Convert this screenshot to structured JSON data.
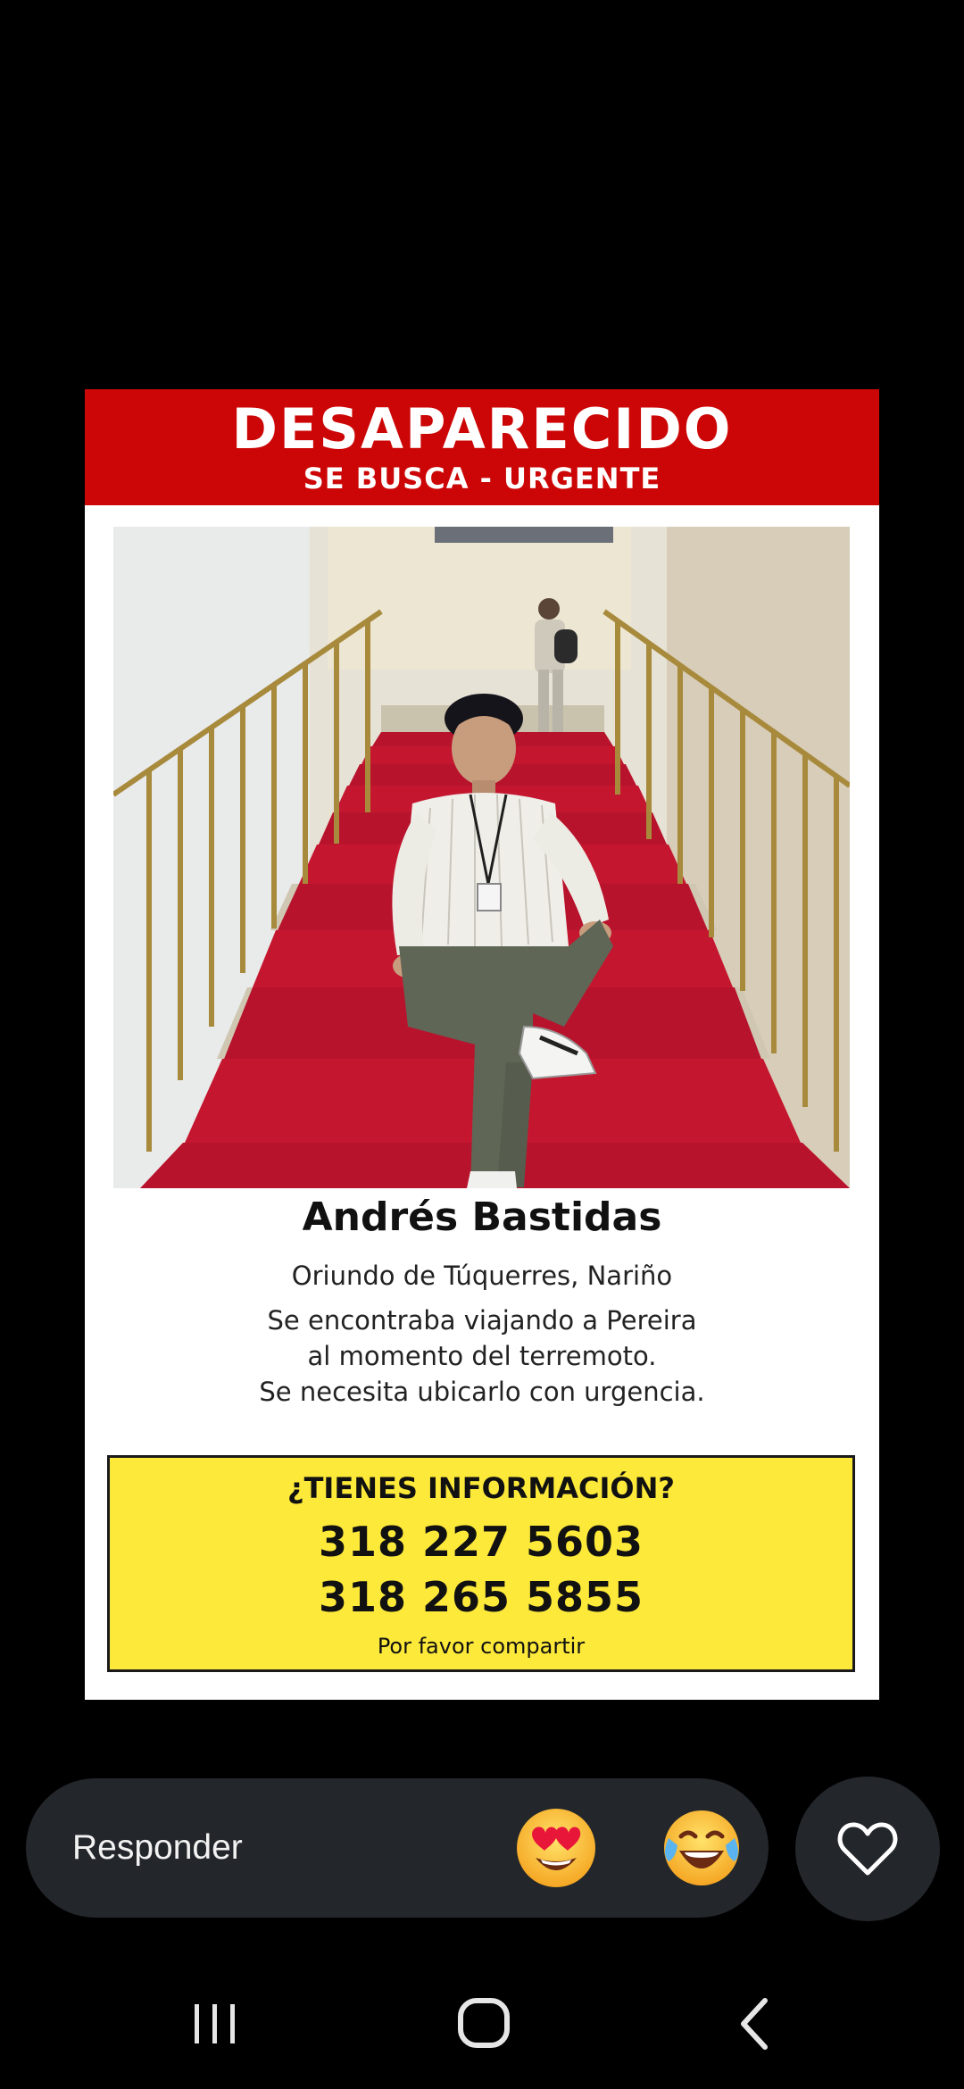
{
  "poster": {
    "title": "DESAPARECIDO",
    "subtitle": "SE BUSCA - URGENTE",
    "name": "Andrés Bastidas",
    "origin": "Oriundo de Túquerres, Nariño",
    "description_lines": [
      "Se encontraba viajando a Pereira",
      "al momento del terremoto.",
      "Se necesita ubicarlo con urgencia."
    ],
    "info_box": {
      "heading": "¿TIENES INFORMACIÓN?",
      "phones": [
        "318 227 5603",
        "318 265 5855"
      ],
      "footer": "Por favor compartir"
    },
    "colors": {
      "banner": "#cc0606",
      "info_box": "#fde93a",
      "carpet": "#b5162a"
    }
  },
  "reply_bar": {
    "placeholder": "Responder",
    "emojis": [
      "heart-eyes-emoji",
      "tears-of-joy-emoji"
    ]
  },
  "like_button": {
    "icon": "heart-outline-icon"
  },
  "nav_bar": {
    "buttons": [
      "recent-apps-icon",
      "home-icon",
      "back-icon"
    ]
  }
}
